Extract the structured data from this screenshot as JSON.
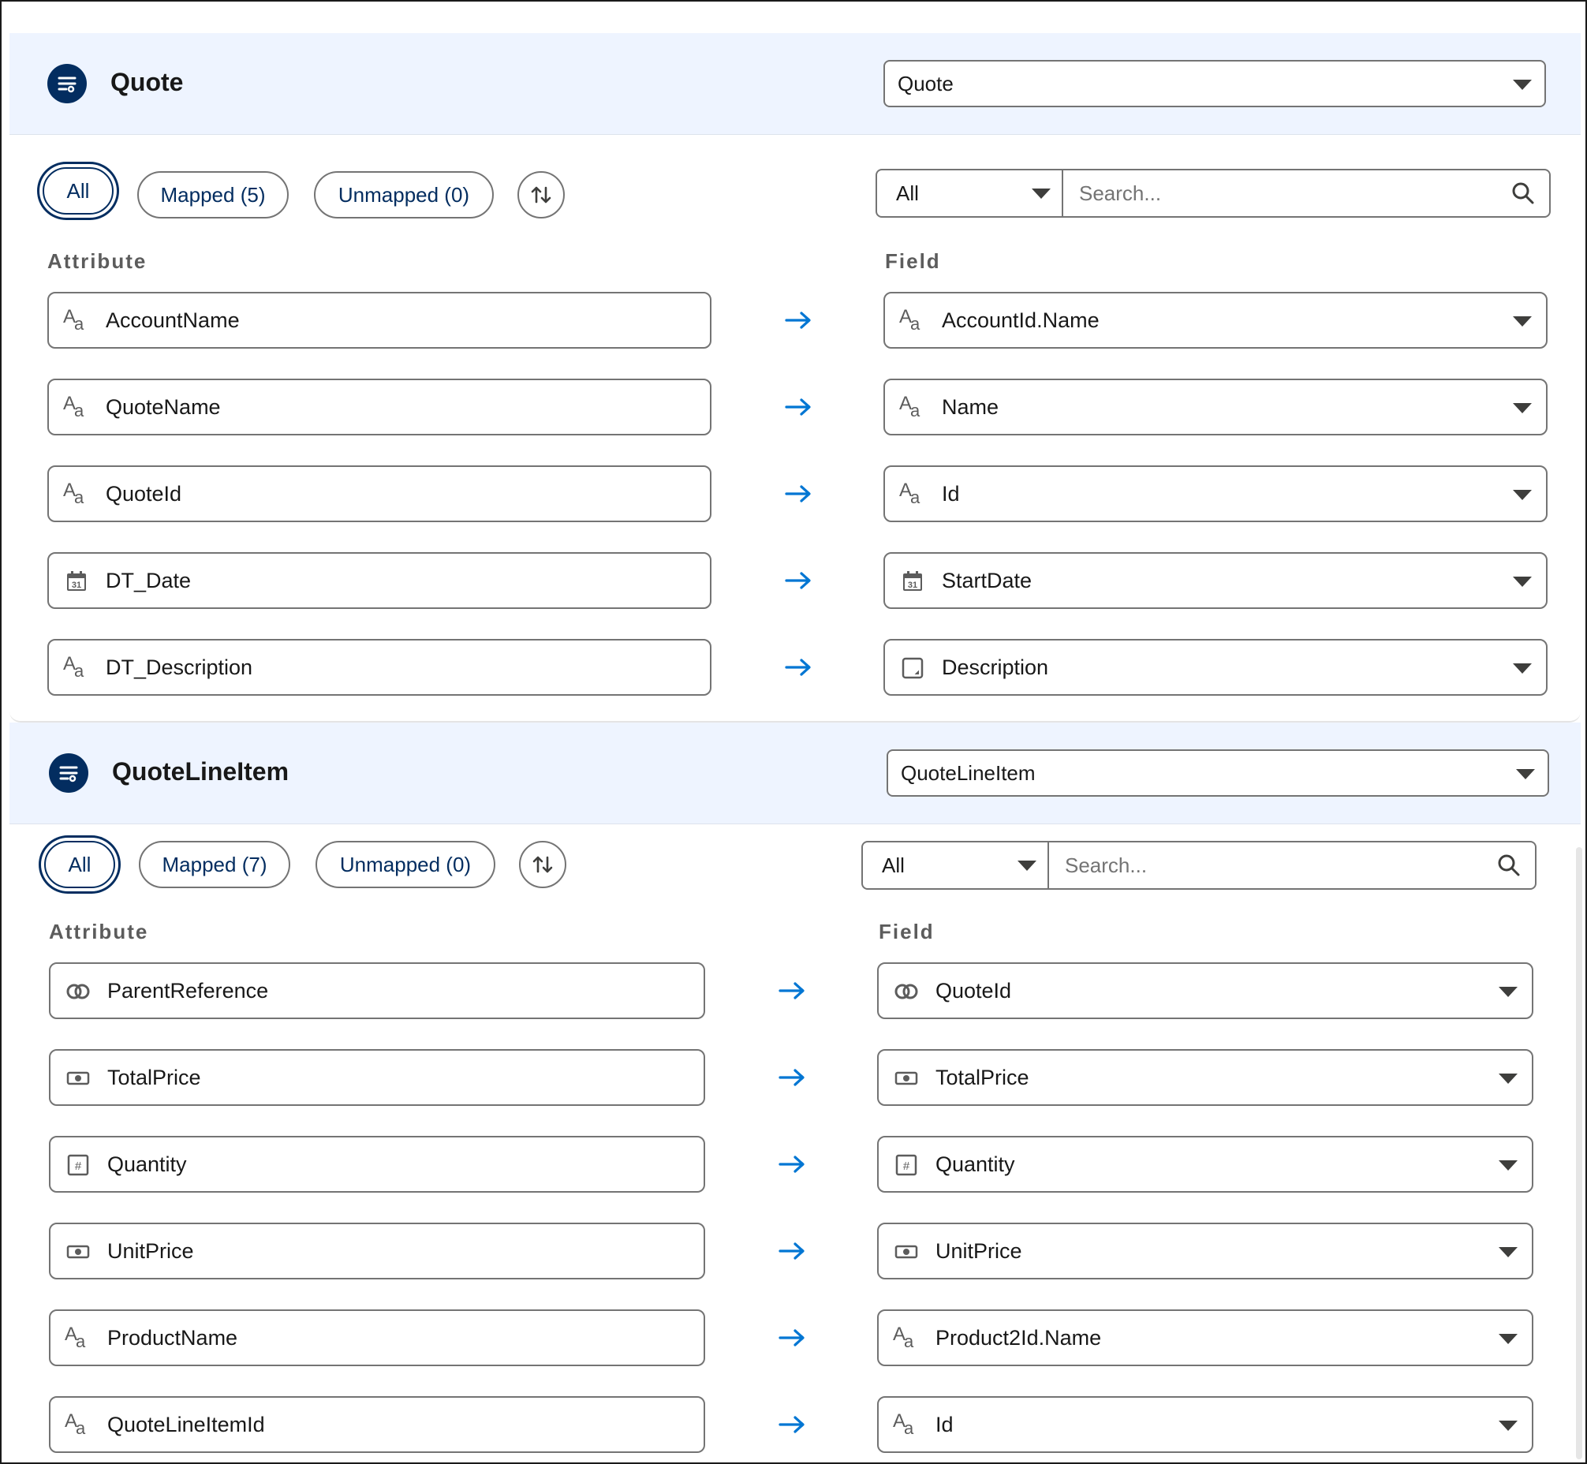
{
  "sections": [
    {
      "title": "Quote",
      "object_select": "Quote",
      "filters": {
        "all": "All",
        "mapped": "Mapped (5)",
        "unmapped": "Unmapped (0)"
      },
      "type_filter": "All",
      "search_placeholder": "Search...",
      "attribute_label": "Attribute",
      "field_label": "Field",
      "rows": [
        {
          "attribute": "AccountName",
          "attribute_icon": "text-icon",
          "field": "AccountId.Name",
          "field_icon": "text-icon"
        },
        {
          "attribute": "QuoteName",
          "attribute_icon": "text-icon",
          "field": "Name",
          "field_icon": "text-icon"
        },
        {
          "attribute": "QuoteId",
          "attribute_icon": "text-icon",
          "field": "Id",
          "field_icon": "text-icon"
        },
        {
          "attribute": "DT_Date",
          "attribute_icon": "calendar-icon",
          "field": "StartDate",
          "field_icon": "calendar-icon"
        },
        {
          "attribute": "DT_Description",
          "attribute_icon": "text-icon",
          "field": "Description",
          "field_icon": "textarea-icon"
        }
      ]
    },
    {
      "title": "QuoteLineItem",
      "object_select": "QuoteLineItem",
      "filters": {
        "all": "All",
        "mapped": "Mapped (7)",
        "unmapped": "Unmapped (0)"
      },
      "type_filter": "All",
      "search_placeholder": "Search...",
      "attribute_label": "Attribute",
      "field_label": "Field",
      "rows": [
        {
          "attribute": "ParentReference",
          "attribute_icon": "reference-icon",
          "field": "QuoteId",
          "field_icon": "reference-icon"
        },
        {
          "attribute": "TotalPrice",
          "attribute_icon": "currency-icon",
          "field": "TotalPrice",
          "field_icon": "currency-icon"
        },
        {
          "attribute": "Quantity",
          "attribute_icon": "number-icon",
          "field": "Quantity",
          "field_icon": "number-icon"
        },
        {
          "attribute": "UnitPrice",
          "attribute_icon": "currency-icon",
          "field": "UnitPrice",
          "field_icon": "currency-icon"
        },
        {
          "attribute": "ProductName",
          "attribute_icon": "text-icon",
          "field": "Product2Id.Name",
          "field_icon": "text-icon"
        },
        {
          "attribute": "QuoteLineItemId",
          "attribute_icon": "text-icon",
          "field": "Id",
          "field_icon": "text-icon"
        }
      ]
    }
  ],
  "calendar_day": "31",
  "colors": {
    "accent": "#0176d3",
    "brand_dark": "#032d60",
    "header_bg": "#eef4ff",
    "border": "#747474"
  }
}
